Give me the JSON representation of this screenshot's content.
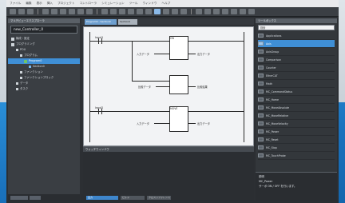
{
  "menu": [
    "ファイル",
    "編集",
    "表示",
    "挿入",
    "プロジェクト",
    "コントローラ",
    "シミュレーション",
    "ツール",
    "ウィンドウ",
    "ヘルプ"
  ],
  "left_panel": {
    "title": "マルチビューエクスプローラ",
    "project": "new_Controller_0",
    "tree": [
      {
        "label": "構成・設定",
        "level": 0,
        "icon": "gear-icon"
      },
      {
        "label": "プログラミング",
        "level": 0,
        "icon": "folder-icon"
      },
      {
        "label": "POU",
        "level": 1,
        "icon": "folder-icon"
      },
      {
        "label": "プログラム",
        "level": 2,
        "icon": "folder-icon"
      },
      {
        "label": "Program0",
        "level": 3,
        "icon": "program-icon",
        "selected": true
      },
      {
        "label": "Section0",
        "level": 4,
        "icon": "section-icon"
      },
      {
        "label": "ファンクション",
        "level": 2,
        "icon": "folder-icon"
      },
      {
        "label": "ファンクションブロック",
        "level": 2,
        "icon": "folder-icon"
      },
      {
        "label": "データ",
        "level": 1,
        "icon": "folder-icon"
      },
      {
        "label": "タスク",
        "level": 1,
        "icon": "folder-icon"
      }
    ],
    "bottom_tabs": [
      "フィルタ",
      "…"
    ]
  },
  "editor": {
    "tabs": [
      "Program0 - Section0",
      "Section0"
    ],
    "rungs": [
      {
        "contact": "Input1",
        "block": "ON",
        "in_label": "入力データ",
        "out_label": "出力データ"
      },
      {
        "in_label": "比較データ",
        "out_label": "比較結果"
      },
      {
        "contact": "Input2",
        "block": "MOVE",
        "in_label": "入力データ",
        "out_label": "出力データ"
      }
    ]
  },
  "watch": {
    "title": "ウォッチウィンドウ"
  },
  "status_tabs": [
    "出力",
    "ビルド",
    "クロスリファレンス"
  ],
  "toolbox": {
    "title": "ツールボックス",
    "search": "検索",
    "items": [
      {
        "label": "Applications",
        "selected": false
      },
      {
        "label": "Axis",
        "selected": true
      },
      {
        "label": "AxisGroup",
        "selected": false
      },
      {
        "label": "Comparison",
        "selected": false
      },
      {
        "label": "Counter",
        "selected": false
      },
      {
        "label": "EtherCAT",
        "selected": false
      },
      {
        "label": "Math",
        "selected": false
      },
      {
        "label": "MC_CommandStatus",
        "selected": false
      },
      {
        "label": "MC_Home",
        "selected": false
      },
      {
        "label": "MC_MoveAbsolute",
        "selected": false
      },
      {
        "label": "MC_MoveRelative",
        "selected": false
      },
      {
        "label": "MC_MoveVelocity",
        "selected": false
      },
      {
        "label": "MC_Power",
        "selected": false
      },
      {
        "label": "MC_Reset",
        "selected": false
      },
      {
        "label": "MC_Stop",
        "selected": false
      },
      {
        "label": "MC_TouchProbe",
        "selected": false
      }
    ],
    "description_title": "説明",
    "description_lines": [
      "MC_Power",
      "サーボ ON / OFF を行います。"
    ]
  },
  "colors": {
    "accent": "#3f8fd6",
    "window_bg": "#2c2f33",
    "backdrop": "#1a72bd"
  }
}
